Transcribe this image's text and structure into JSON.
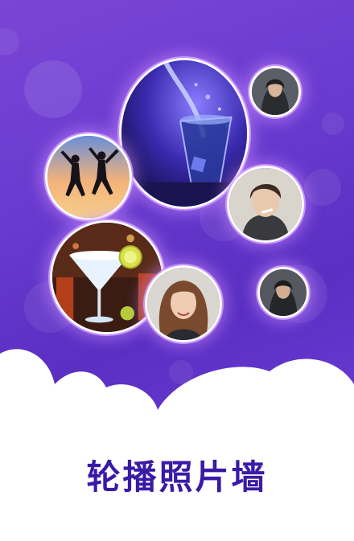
{
  "page": {
    "title": "轮播照片墙"
  },
  "photos": [
    {
      "subject": "cocktail-glass-splash-photo"
    },
    {
      "subject": "hooded-man-photo-top"
    },
    {
      "subject": "jumping-people-sunset-photo"
    },
    {
      "subject": "young-man-portrait-photo"
    },
    {
      "subject": "margarita-cocktail-photo"
    },
    {
      "subject": "woman-portrait-photo"
    },
    {
      "subject": "hooded-man-photo-bottom"
    }
  ],
  "colors": {
    "gradient_start": "#7a45d6",
    "gradient_end": "#5a2fc2",
    "title": "#3a1aa6",
    "glow": "#d2a0ff"
  }
}
